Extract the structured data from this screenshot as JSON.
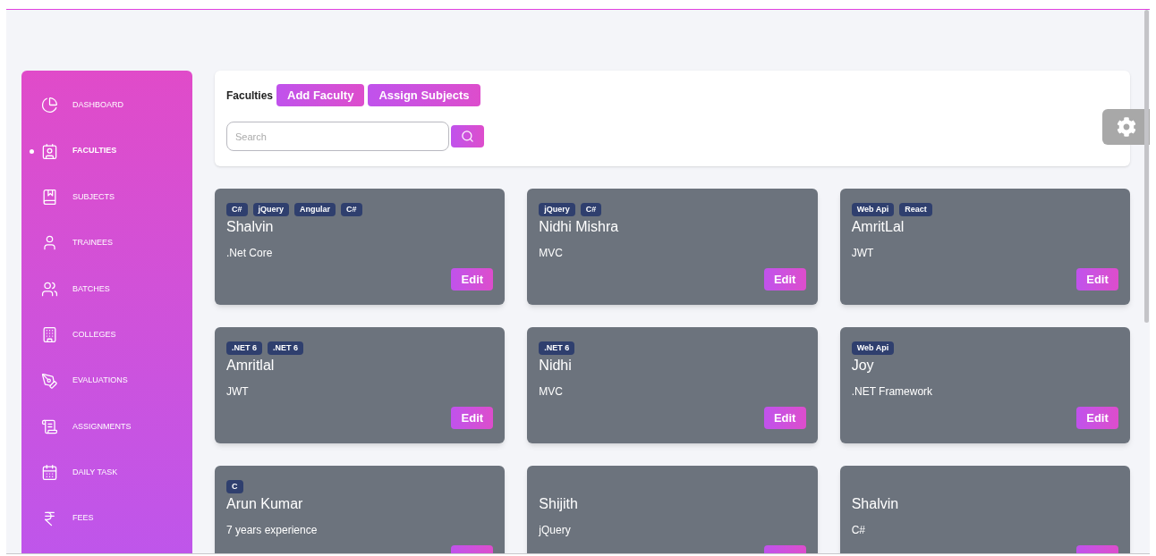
{
  "sidebar": {
    "items": [
      {
        "label": "DASHBOARD",
        "selected": false
      },
      {
        "label": "FACULTIES",
        "selected": true
      },
      {
        "label": "SUBJECTS",
        "selected": false
      },
      {
        "label": "TRAINEES",
        "selected": false
      },
      {
        "label": "BATCHES",
        "selected": false
      },
      {
        "label": "COLLEGES",
        "selected": false
      },
      {
        "label": "EVALUATIONS",
        "selected": false
      },
      {
        "label": "ASSIGNMENTS",
        "selected": false
      },
      {
        "label": "DAILY TASK",
        "selected": false
      },
      {
        "label": "FEES",
        "selected": false
      }
    ]
  },
  "header": {
    "title": "Faculties",
    "buttons": [
      "Add Faculty",
      "Assign Subjects"
    ],
    "search": {
      "placeholder": "Search"
    }
  },
  "cards": [
    {
      "tags": [
        "C#",
        "jQuery",
        "Angular",
        "C#"
      ],
      "name": "Shalvin",
      "subtitle": ".Net Core",
      "edit": "Edit"
    },
    {
      "tags": [
        "jQuery",
        "C#"
      ],
      "name": "Nidhi Mishra",
      "subtitle": "MVC",
      "edit": "Edit"
    },
    {
      "tags": [
        "Web Api",
        "React"
      ],
      "name": "AmritLal",
      "subtitle": "JWT",
      "edit": "Edit"
    },
    {
      "tags": [
        ".NET 6",
        ".NET 6"
      ],
      "name": "Amritlal",
      "subtitle": "JWT",
      "edit": "Edit"
    },
    {
      "tags": [
        ".NET 6"
      ],
      "name": "Nidhi",
      "subtitle": "MVC",
      "edit": "Edit"
    },
    {
      "tags": [
        "Web Api"
      ],
      "name": "Joy",
      "subtitle": ".NET Framework",
      "edit": "Edit"
    },
    {
      "tags": [
        "C"
      ],
      "name": "Arun Kumar",
      "subtitle": "7 years experience"
    },
    {
      "name": "Shijith",
      "subtitle": "jQuery"
    },
    {
      "name": "Shalvin",
      "subtitle": "C#"
    }
  ]
}
